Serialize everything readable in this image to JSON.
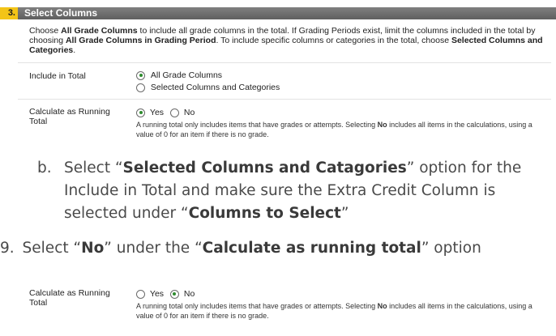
{
  "section": {
    "number": "3.",
    "title": "Select Columns",
    "description_parts": [
      "Choose ",
      "All Grade Columns",
      " to include all grade columns in the total. If Grading Periods exist, limit the columns included in the total by choosing ",
      "All Grade Columns in Grading Period",
      ". To include specific columns or categories in the total, choose ",
      "Selected Columns and Categories",
      "."
    ],
    "include_in_total": {
      "label": "Include in Total",
      "options": [
        "All Grade Columns",
        "Selected Columns and Categories"
      ],
      "selected": "All Grade Columns"
    },
    "running_total": {
      "label": "Calculate as Running Total",
      "yes": "Yes",
      "no": "No",
      "selected": "Yes",
      "help_parts": [
        "A running total only includes items that have grades or attempts. Selecting ",
        "No",
        " includes all items in the calculations, using a value of 0 for an item if there is no grade."
      ]
    }
  },
  "instructions": {
    "step_b": {
      "marker": "b.",
      "parts": [
        "Select “",
        "Selected Columns and Catagories",
        "” option for the Include in Total and make sure the Extra Credit Column is selected under “",
        "Columns to Select",
        "”"
      ]
    },
    "step_9": {
      "marker": "9.",
      "parts": [
        "Select “",
        "No",
        "” under the “",
        "Calculate as running total",
        "” option"
      ]
    }
  },
  "second_running_total": {
    "label": "Calculate as Running Total",
    "yes": "Yes",
    "no": "No",
    "selected": "No",
    "help_parts": [
      "A running total only includes items that have grades or attempts. Selecting ",
      "No",
      " includes all items in the calculations, using a value of 0 for an item if there is no grade."
    ]
  },
  "colors": {
    "header_bar": "#6f6f6f",
    "number_tab": "#f3c417",
    "radio_selected": "#2e8b2e"
  }
}
